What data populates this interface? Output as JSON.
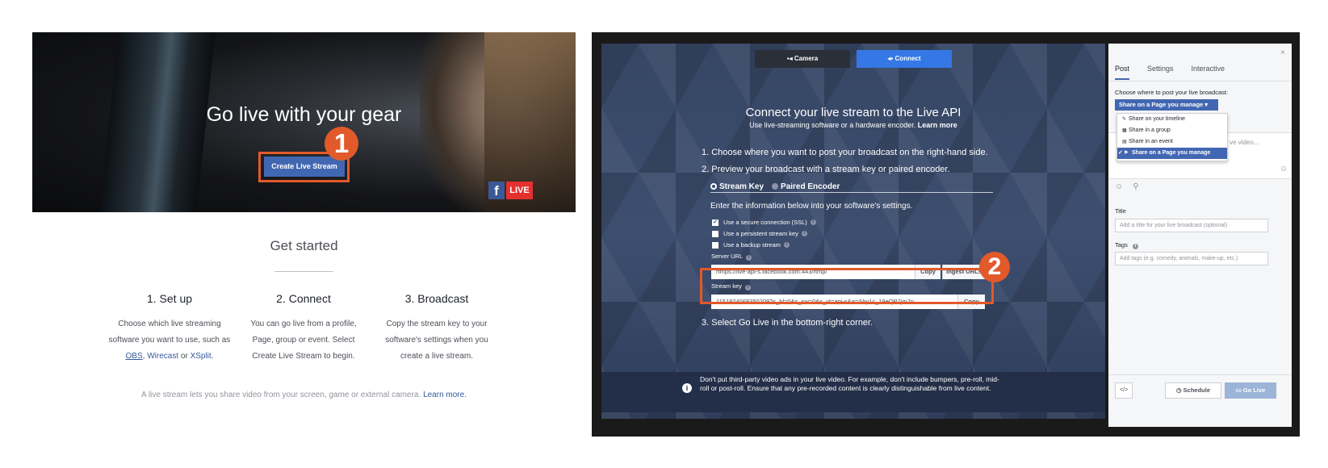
{
  "left": {
    "hero_title": "Go live with your gear",
    "create_button": "Create Live Stream",
    "badge_1": "1",
    "fb_logo": "f",
    "live_tag": "LIVE",
    "get_started": "Get started",
    "columns": [
      {
        "heading": "1. Set up",
        "text_pre": "Choose which live streaming software you want to use, such as ",
        "link1": "OBS",
        "sep1": ", ",
        "link2": "Wirecast",
        "sep2": " or ",
        "link3": "XSplit",
        "end": "."
      },
      {
        "heading": "2. Connect",
        "text": "You can go live from a profile, Page, group or event. Select Create Live Stream to begin."
      },
      {
        "heading": "3. Broadcast",
        "text": "Copy the stream key to your software's settings when you create a live stream."
      }
    ],
    "footnote_text": "A live stream lets you share video from your screen, game or external camera. ",
    "footnote_link": "Learn more."
  },
  "right": {
    "tabs": {
      "camera": "Camera",
      "connect": "Connect"
    },
    "title": "Connect your live stream to the Live API",
    "subtitle": "Use live-streaming software or a hardware encoder. ",
    "subtitle_link": "Learn more",
    "step1": "1. Choose where you want to post your broadcast on the right-hand side.",
    "step2": "2. Preview your broadcast with a stream key or paired encoder.",
    "radio_stream_key": "Stream Key",
    "radio_paired": "Paired Encoder",
    "enter_info": "Enter the information below into your software's settings.",
    "checks": [
      {
        "label": "Use a secure connection (SSL)",
        "checked": true
      },
      {
        "label": "Use a persistent stream key",
        "checked": false
      },
      {
        "label": "Use a backup stream",
        "checked": false
      }
    ],
    "server_url_label": "Server URL",
    "server_url": "rtmps://live-api-s.facebook.com:443/rtmp/",
    "copy": "Copy",
    "ingest": "Ingest URLs",
    "stream_key_label": "Stream key",
    "stream_key": "1151924068350209?s_bl=0&s_sw=0&s_vt=api-s&a=Aby1c_19eQP7jm7n",
    "badge_2": "2",
    "step3": "3. Select Go Live in the bottom-right corner.",
    "notice": "Don't put third-party video ads in your live video. For example, don't include bumpers, pre-roll, mid-roll or post-roll. Ensure that any pre-recorded content is clearly distinguishable from live content."
  },
  "side": {
    "close": "×",
    "tabs": [
      "Post",
      "Settings",
      "Interactive"
    ],
    "choose": "Choose where to post your live broadcast:",
    "share_button": "Share on a Page you manage",
    "menu": [
      {
        "label": "Share on your timeline",
        "icon": "edit-icon",
        "selected": false
      },
      {
        "label": "Share in a group",
        "icon": "group-icon",
        "selected": false
      },
      {
        "label": "Share in an event",
        "icon": "calendar-icon",
        "selected": false
      },
      {
        "label": "Share on a Page you manage",
        "icon": "flag-icon",
        "selected": true
      }
    ],
    "textarea_fragment": "ve video...",
    "title_label": "Title",
    "title_placeholder": "Add a title for your live broadcast (optional)",
    "tags_label": "Tags",
    "tags_placeholder": "Add tags (e.g. comedy, animals, make-up, etc.)",
    "embed": "</>",
    "schedule": "Schedule",
    "go_live": "Go Live"
  },
  "colors": {
    "accent": "#4267b2",
    "highlight": "#e25a2a",
    "live_red": "#e4312f",
    "connect_blue": "#3578e5"
  }
}
